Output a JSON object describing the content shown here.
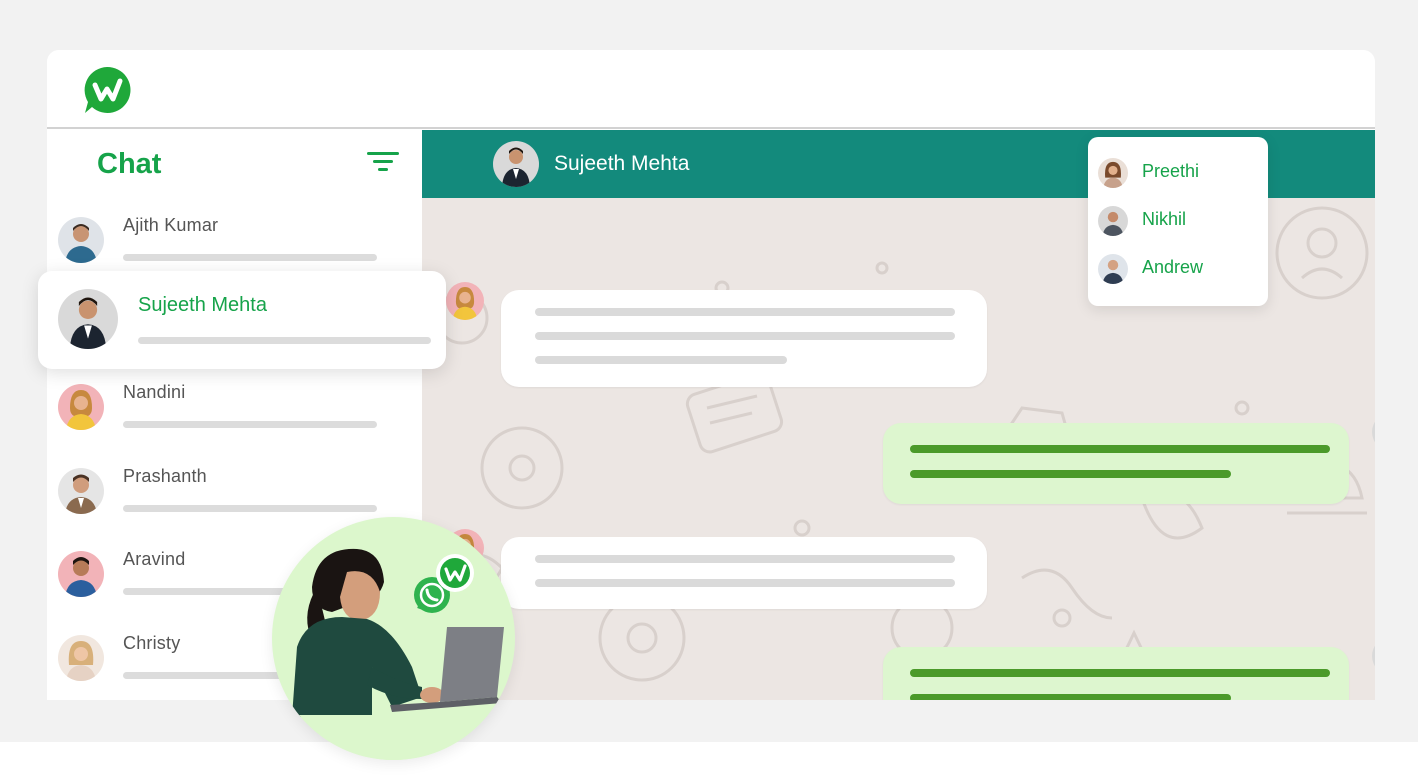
{
  "app": {
    "logo_icon": "w-chat-logo-icon",
    "brand_color": "#16a34a",
    "header_color": "#138a7c"
  },
  "sidebar": {
    "title": "Chat",
    "filter_icon": "filter-icon",
    "contacts": [
      {
        "name": "Ajith Kumar",
        "selected": false
      },
      {
        "name": "Sujeeth Mehta",
        "selected": true
      },
      {
        "name": "Nandini",
        "selected": false
      },
      {
        "name": "Prashanth",
        "selected": false
      },
      {
        "name": "Aravind",
        "selected": false
      },
      {
        "name": "Christy",
        "selected": false
      }
    ]
  },
  "conversation": {
    "contact_name": "Sujeeth Mehta",
    "messages": [
      {
        "direction": "incoming",
        "lines": 3
      },
      {
        "direction": "outgoing",
        "lines": 2
      },
      {
        "direction": "incoming",
        "lines": 2
      },
      {
        "direction": "outgoing",
        "lines": 2
      }
    ]
  },
  "mention_popup": {
    "items": [
      {
        "name": "Preethi"
      },
      {
        "name": "Nikhil"
      },
      {
        "name": "Andrew"
      }
    ]
  },
  "promo": {
    "icons": [
      "whatsapp-icon",
      "w-chat-badge-icon"
    ]
  }
}
